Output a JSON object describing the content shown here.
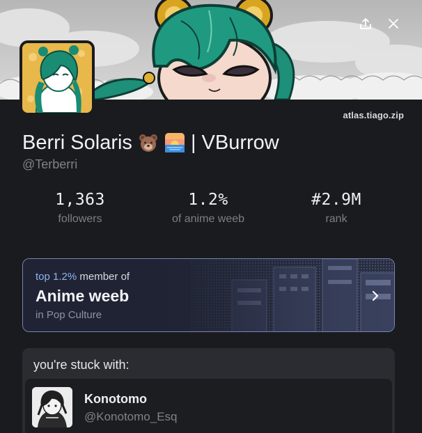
{
  "header": {
    "actions": [
      {
        "icon": "share-icon"
      },
      {
        "icon": "close-icon"
      }
    ]
  },
  "profile": {
    "site_link": "atlas.tiago.zip",
    "name_first": "Berri Solaris",
    "emoji_1": "bear-face-emoji",
    "emoji_2": "sunrise-emoji",
    "name_second": "| VBurrow",
    "handle": "@Terberri"
  },
  "stats": [
    {
      "value": "1,363",
      "label": "followers"
    },
    {
      "value": "1.2%",
      "label": "of anime weeb"
    },
    {
      "value": "#2.9M",
      "label": "rank"
    }
  ],
  "membership": {
    "top_highlight": "top 1.2%",
    "top_rest": " member of",
    "title": "Anime weeb",
    "subtitle": "in Pop Culture",
    "chevron_icon": "chevron-right-icon"
  },
  "stuck_with": {
    "title": "you're stuck with:",
    "items": [
      {
        "name": "Konotomo",
        "handle": "@Konotomo_Esq"
      }
    ]
  },
  "colors": {
    "accent": "#8fb3f3",
    "card_border": "#7885b8",
    "background": "#1a1b1f"
  }
}
